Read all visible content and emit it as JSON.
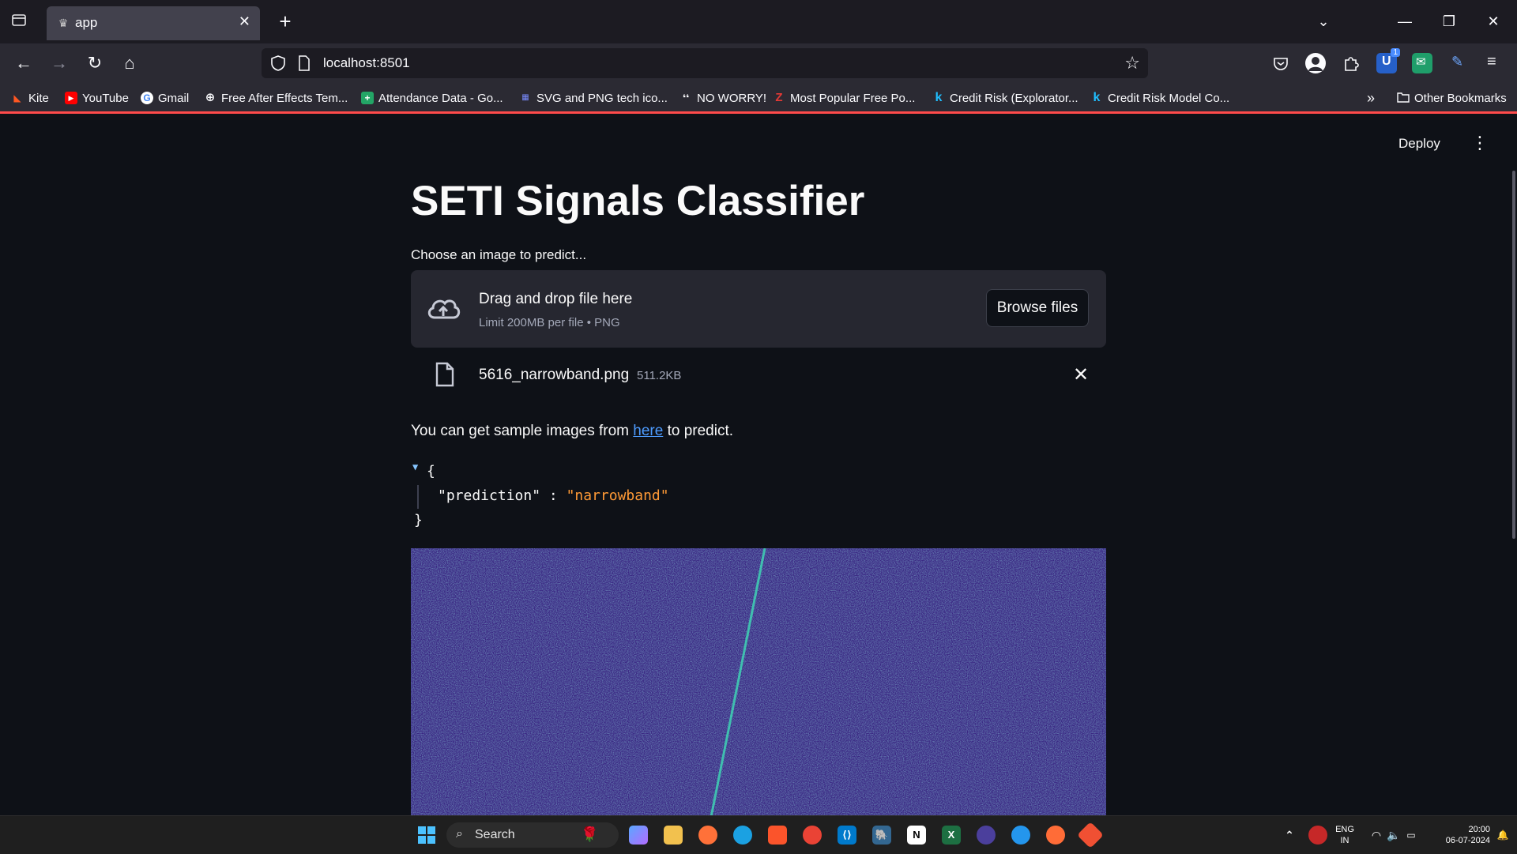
{
  "browser": {
    "tab_title": "app",
    "url": "localhost:8501",
    "bookmarks": [
      {
        "label": "Kite"
      },
      {
        "label": "YouTube"
      },
      {
        "label": "Gmail"
      },
      {
        "label": "Free After Effects Tem..."
      },
      {
        "label": "Attendance Data - Go..."
      },
      {
        "label": "SVG and PNG tech ico..."
      },
      {
        "label": "NO WORRY!"
      },
      {
        "label": "Most Popular Free Po..."
      },
      {
        "label": "Credit Risk (Explorator..."
      },
      {
        "label": "Credit Risk Model Co..."
      }
    ],
    "other_bookmarks": "Other Bookmarks",
    "extension_badge": "1"
  },
  "app": {
    "deploy_label": "Deploy",
    "title": "SETI Signals Classifier",
    "uploader": {
      "label": "Choose an image to predict...",
      "drop_title": "Drag and drop file here",
      "limit": "Limit 200MB per file • PNG",
      "browse_label": "Browse files"
    },
    "file": {
      "name": "5616_narrowband.png",
      "size": "511.2KB"
    },
    "sample": {
      "before": "You can get sample images from ",
      "link": "here",
      "after": " to predict."
    },
    "json": {
      "open": "{",
      "key": "\"prediction\"",
      "sep": " : ",
      "value": "\"narrowband\"",
      "close": "}"
    }
  },
  "taskbar": {
    "search_label": "Search",
    "lang": "ENG",
    "region": "IN",
    "time": "20:00",
    "date": "06-07-2024"
  },
  "colors": {
    "app_bg": "#0e1117",
    "accent_red": "#ff4b4b",
    "link_blue": "#4e9cff",
    "json_value_orange": "#ff9a36",
    "spectrogram_bg": "#3b2a86"
  }
}
